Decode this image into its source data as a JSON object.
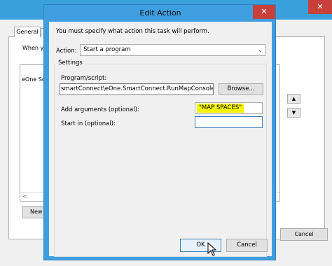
{
  "background_window": {
    "close_glyph": "✕",
    "tab_general": "General",
    "when_text": "When y",
    "list_item": "eOne So",
    "scroll_left_glyph": "<",
    "new_button": "New",
    "up_glyph": "▲",
    "down_glyph": "▼",
    "cancel_button": "Cancel"
  },
  "dialog": {
    "title": "Edit Action",
    "close_glyph": "✕",
    "instruction": "You must specify what action this task will perform.",
    "action_label": "Action:",
    "action_value": "Start a program",
    "caret_glyph": "⌄",
    "settings_label": "Settings",
    "program_label": "Program/script:",
    "program_value": "smartConnect\\eOne.SmartConnect.RunMapConsole.exe\"",
    "browse_button": "Browse...",
    "arguments_label": "Add arguments (optional):",
    "arguments_value": "\"MAP SPACES\"",
    "start_in_label": "Start in (optional):",
    "start_in_value": "",
    "ok_button": "OK",
    "cancel_button": "Cancel"
  },
  "colors": {
    "titlebar_blue": "#3f9ee0",
    "close_red": "#c7413a",
    "highlight_yellow": "#f5f500"
  },
  "icons": {
    "cursor": "mouse-pointer-icon"
  }
}
